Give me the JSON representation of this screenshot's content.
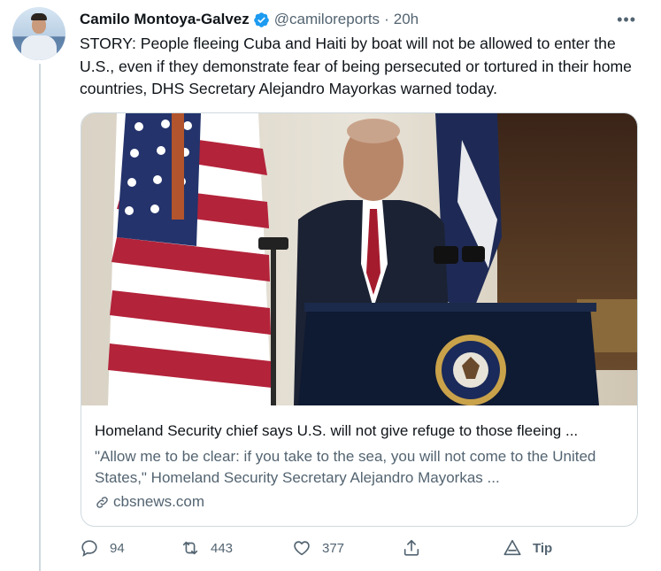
{
  "tweet": {
    "author_name": "Camilo Montoya-Galvez",
    "handle": "@camiloreports",
    "separator": "·",
    "time": "20h",
    "more_label": "•••",
    "text": "STORY: People fleeing Cuba and Haiti by boat will not be allowed to enter the U.S., even if they demonstrate fear of being persecuted or tortured in their home countries, DHS Secretary Alejandro Mayorkas warned today.",
    "verified_icon": "verified-badge-icon",
    "verified_color": "#1d9bf0"
  },
  "card": {
    "title": "Homeland Security chief says U.S. will not give refuge to those fleeing ...",
    "description": "\"Allow me to be clear: if you take to the sea, you will not come to the United States,\" Homeland Security Secretary Alejandro Mayorkas ...",
    "domain": "cbsnews.com",
    "image_subject": "Official at podium with presidential seal in front of U.S. flag"
  },
  "actions": {
    "reply_count": "94",
    "retweet_count": "443",
    "like_count": "377",
    "tip_label": "Tip"
  },
  "colors": {
    "text_primary": "#0f1419",
    "text_secondary": "#536471",
    "border": "#cfd9de"
  }
}
